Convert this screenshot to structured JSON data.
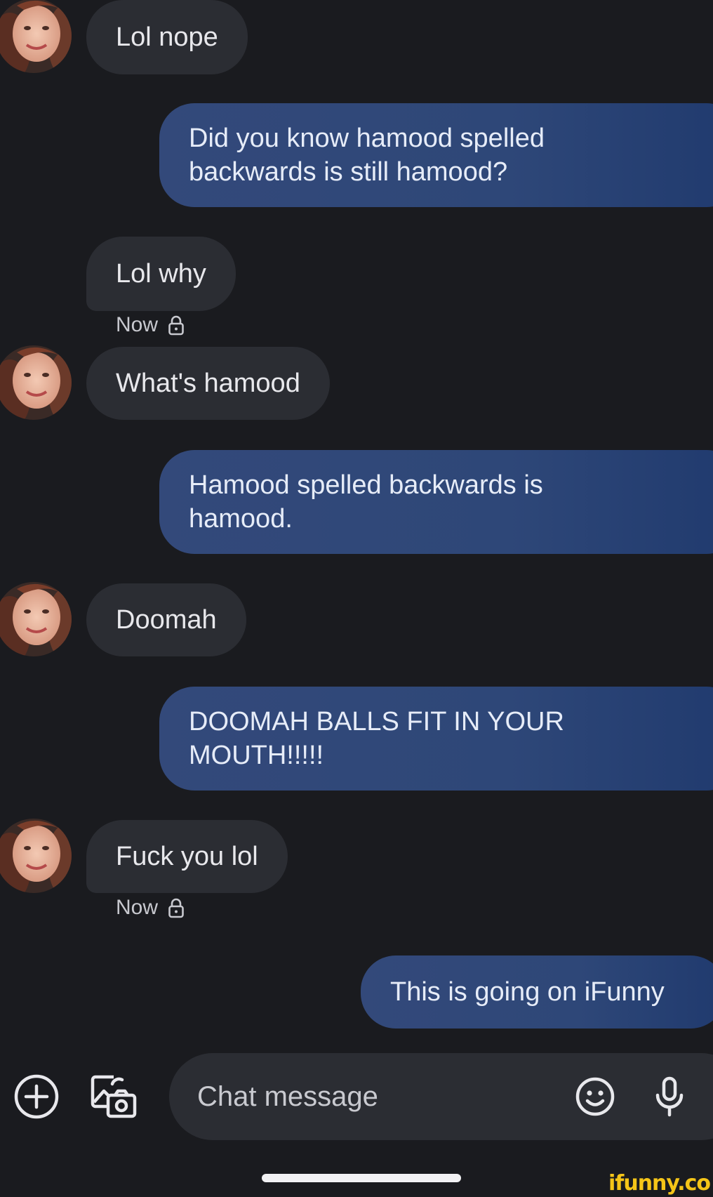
{
  "messages": [
    {
      "id": "m1",
      "direction": "incoming",
      "text": "Lol nope"
    },
    {
      "id": "m2",
      "direction": "outgoing",
      "lines": [
        "Did you know hamood spelled",
        "backwards is still hamood?"
      ]
    },
    {
      "id": "m3",
      "direction": "incoming",
      "text": "Lol why",
      "timestamp": "Now"
    },
    {
      "id": "m4",
      "direction": "incoming",
      "text": "What's hamood"
    },
    {
      "id": "m5",
      "direction": "outgoing",
      "lines": [
        "Hamood spelled backwards is",
        "hamood."
      ]
    },
    {
      "id": "m6",
      "direction": "incoming",
      "text": "Doomah"
    },
    {
      "id": "m7",
      "direction": "outgoing",
      "lines": [
        "DOOMAH BALLS FIT IN YOUR",
        "MOUTH!!!!!"
      ]
    },
    {
      "id": "m8",
      "direction": "incoming",
      "text": "Fuck you lol",
      "timestamp": "Now"
    },
    {
      "id": "m9",
      "direction": "outgoing",
      "text": "This is going on iFunny"
    }
  ],
  "composer": {
    "placeholder": "Chat message",
    "icons": [
      "add-circle-icon",
      "gallery-camera-icon",
      "emoji-icon",
      "microphone-icon"
    ]
  },
  "watermark": "ifunny.co",
  "colors": {
    "background": "#1a1b1f",
    "incoming_bubble": "#2b2d33",
    "outgoing_bubble": "#2e4778",
    "watermark": "#f5c518"
  }
}
